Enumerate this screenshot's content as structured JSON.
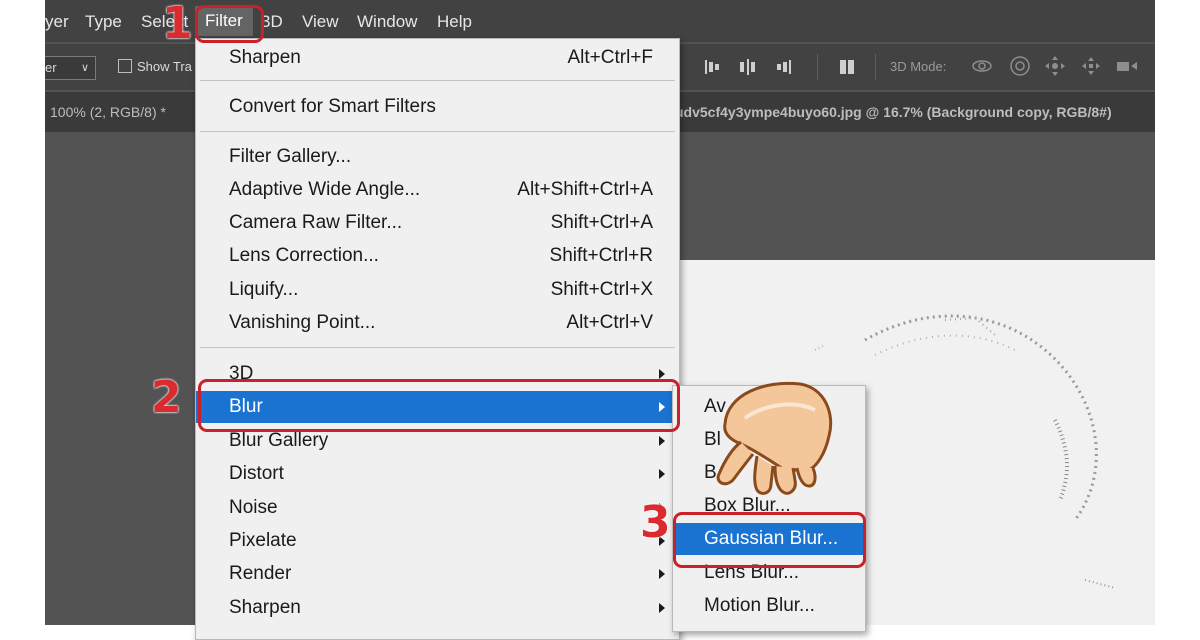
{
  "menubar": {
    "items": [
      "yer",
      "Type",
      "Select",
      "Filter",
      "3D",
      "View",
      "Window",
      "Help"
    ]
  },
  "optbar": {
    "select_label": "er",
    "show_transform_label": "Show Tra",
    "mode_3d_label": "3D Mode:"
  },
  "tabs": {
    "doc1": "100% (2, RGB/8) *",
    "doc2": "udv5cf4y3ympe4buyo60.jpg @ 16.7% (Background copy, RGB/8#)"
  },
  "filter_menu": {
    "last_filter": {
      "label": "Sharpen",
      "shortcut": "Alt+Ctrl+F"
    },
    "convert": "Convert for Smart Filters",
    "group1": [
      {
        "label": "Filter Gallery...",
        "shortcut": ""
      },
      {
        "label": "Adaptive Wide Angle...",
        "shortcut": "Alt+Shift+Ctrl+A"
      },
      {
        "label": "Camera Raw Filter...",
        "shortcut": "Shift+Ctrl+A"
      },
      {
        "label": "Lens Correction...",
        "shortcut": "Shift+Ctrl+R"
      },
      {
        "label": "Liquify...",
        "shortcut": "Shift+Ctrl+X"
      },
      {
        "label": "Vanishing Point...",
        "shortcut": "Alt+Ctrl+V"
      }
    ],
    "group2": [
      "3D",
      "Blur",
      "Blur Gallery",
      "Distort",
      "Noise",
      "Pixelate",
      "Render",
      "Sharpen"
    ]
  },
  "blur_menu": {
    "items": [
      "Average",
      "Blur",
      "Blur More",
      "Box Blur...",
      "Gaussian Blur...",
      "Lens Blur...",
      "Motion Blur..."
    ],
    "visible": [
      "Av",
      "Bl",
      "B",
      "Box Blur...",
      "Gaussian Blur...",
      "Lens Blur...",
      "Motion Blur..."
    ]
  },
  "steps": [
    "1",
    "2",
    "3"
  ],
  "colors": {
    "highlight": "#1a73d1",
    "annotation": "#c9202a",
    "menu_bg": "#f0f0f0",
    "app_bg": "#535353"
  }
}
